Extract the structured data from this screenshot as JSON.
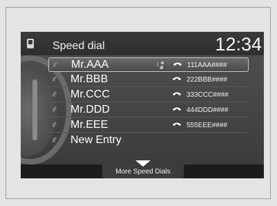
{
  "header": {
    "title": "Speed dial",
    "time": "12:34"
  },
  "entries": [
    {
      "name": "Mr.AAA",
      "number": "111AAA####",
      "voice_tag": true
    },
    {
      "name": "Mr.BBB",
      "number": "222BBB####"
    },
    {
      "name": "Mr.CCC",
      "number": "333CCC####"
    },
    {
      "name": "Mr.DDD",
      "number": "444DDD####"
    },
    {
      "name": "Mr.EEE",
      "number": "555EEE####"
    }
  ],
  "new_entry_label": "New Entry",
  "more_label": "More Speed Dials",
  "icons": {
    "header": "phone-icon",
    "row": "handset-icon",
    "voice": "voice-tag-icon",
    "number": "phone-number-icon",
    "more": "down-triangle-icon"
  }
}
